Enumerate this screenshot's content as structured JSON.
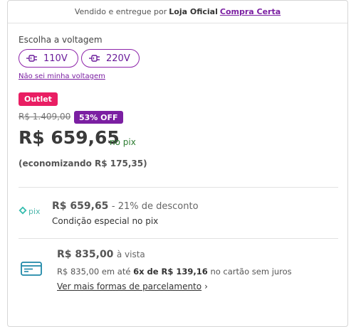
{
  "seller": {
    "prefix": "Vendido e entregue por",
    "name": "Loja Oficial",
    "link": "Compra Certa"
  },
  "voltage": {
    "label": "Escolha a voltagem",
    "options": [
      "110V",
      "220V"
    ],
    "unknown_link": "Não sei minha voltagem"
  },
  "badges": {
    "outlet": "Outlet",
    "discount": "53% OFF"
  },
  "price": {
    "old": "R$ 1.409,00",
    "current": "R$ 659,65",
    "current_suffix": "no pix",
    "saving": "(economizando R$ 175,35)"
  },
  "pix": {
    "logo_text": "pix",
    "price": "R$ 659,65",
    "discount": "- 21% de desconto",
    "condition": "Condição especial no pix"
  },
  "card": {
    "cash_price": "R$ 835,00",
    "cash_suffix": "à vista",
    "inst_prefix": "R$ 835,00 em até",
    "inst_highlight": "6x de R$ 139,16",
    "inst_suffix": "no cartão sem juros",
    "more_link": "Ver mais formas de parcelamento"
  },
  "colors": {
    "brand_purple": "#7b1fa2",
    "outlet_pink": "#e91e63",
    "pix_green": "#2e7d32",
    "pix_teal": "#32bcad",
    "card_icon": "#1e88a8"
  }
}
